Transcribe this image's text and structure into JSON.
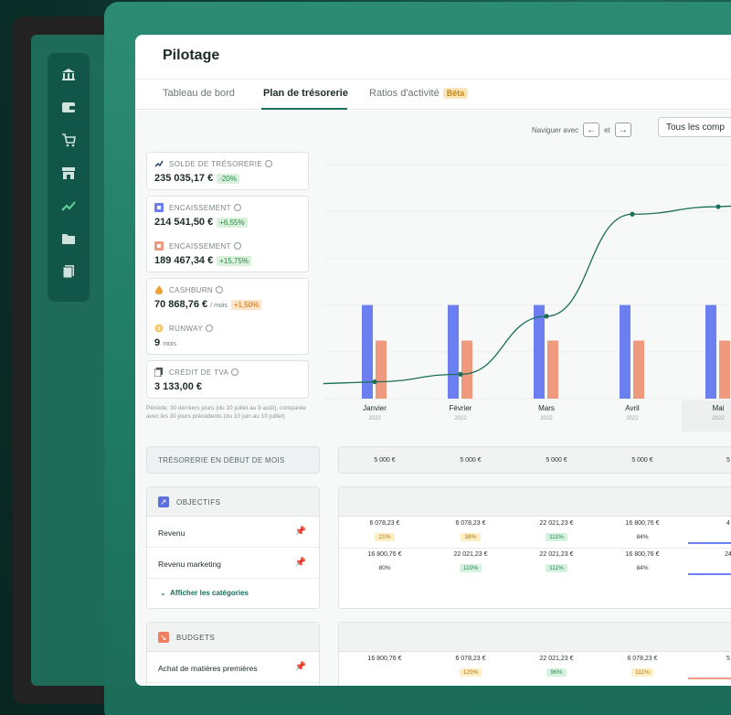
{
  "app": {
    "title": "Pilotage",
    "tabs": [
      {
        "label": "Tableau de bord",
        "active": false
      },
      {
        "label": "Plan de trésorerie",
        "active": true
      },
      {
        "label": "Ratios d'activité",
        "active": false,
        "badge": "Bêta"
      }
    ]
  },
  "toolbar": {
    "nav_text_before": "Naviguer avec",
    "nav_text_middle": "et",
    "left_key": "←",
    "right_key": "→",
    "filter_value": "Tous les comp"
  },
  "sidebar_icons": [
    "bank-icon",
    "wallet-icon",
    "cart-icon",
    "store-icon",
    "trend-icon",
    "folder-icon",
    "documents-icon"
  ],
  "kpis": {
    "solde": {
      "label": "SOLDE DE TRÉSORERIE",
      "value": "235 035,17 €",
      "delta": "-20%"
    },
    "encaissement_in": {
      "label": "ENCAISSEMENT",
      "value": "214 541,50 €",
      "delta": "+6,55%"
    },
    "encaissement_out": {
      "label": "ENCAISSEMENT",
      "value": "189 467,34 €",
      "delta": "+15,75%"
    },
    "cashburn": {
      "label": "CASHBURN",
      "value": "70 868,76 €",
      "unit": "/ mois",
      "delta": "+1,50%"
    },
    "runway": {
      "label": "RUNWAY",
      "value": "9",
      "unit": "mois"
    },
    "credit_tva": {
      "label": "CRÉDIT DE TVA",
      "value": "3 133,00 €"
    }
  },
  "period_note": "Période: 30 derniers jours (du 10 juillet au 9 août), comparée avec les 30 jours précédents (du 10 juin au 10 juillet)",
  "colors": {
    "brand": "#1a6e5a",
    "bar_in": "#6b7ff0",
    "bar_out": "#ef9a7f",
    "line": "#1a6e5a"
  },
  "chart_data": {
    "type": "bar",
    "categories": [
      "Janvier",
      "Février",
      "Mars",
      "Avril",
      "Mai"
    ],
    "category_years": [
      "2022",
      "2022",
      "2022",
      "2022",
      "2022"
    ],
    "series": [
      {
        "name": "",
        "type": "bar",
        "values": [
          100,
          100,
          100,
          100,
          100
        ]
      },
      {
        "name": "",
        "type": "bar",
        "values": [
          62,
          62,
          62,
          62,
          62
        ]
      },
      {
        "name": "",
        "type": "line",
        "values": [
          18,
          26,
          88,
          197,
          205
        ]
      }
    ],
    "ylim": [
      0,
      250
    ],
    "grid": true,
    "xlabel": "",
    "ylabel": ""
  },
  "treso_debut": {
    "label": "TRÉSORERIE EN DÉBUT DE MOIS",
    "values": [
      "5 000 €",
      "5 000 €",
      "5 000 €",
      "5 000 €",
      "5"
    ]
  },
  "objectifs": {
    "title": "OBJECTIFS",
    "rows": [
      {
        "label": "Revenu",
        "values": [
          {
            "amount": "6 078,23 €",
            "pct": "21%",
            "style": "yellow"
          },
          {
            "amount": "6 078,23 €",
            "pct": "38%",
            "style": "yellow"
          },
          {
            "amount": "22 021,23 €",
            "pct": "111%",
            "style": "green"
          },
          {
            "amount": "16 800,76 €",
            "pct": "84%",
            "style": "plain"
          },
          {
            "amount": "4",
            "pct": "",
            "style": "plain"
          }
        ]
      },
      {
        "label": "Revenu marketing",
        "values": [
          {
            "amount": "16 800,76 €",
            "pct": "80%",
            "style": "plain"
          },
          {
            "amount": "22 021,23 €",
            "pct": "110%",
            "style": "green"
          },
          {
            "amount": "22 021,23 €",
            "pct": "111%",
            "style": "green"
          },
          {
            "amount": "16 800,76 €",
            "pct": "84%",
            "style": "plain"
          },
          {
            "amount": "24",
            "pct": "",
            "style": "plain"
          }
        ]
      }
    ],
    "show_categories": "Afficher les catégories"
  },
  "budgets": {
    "title": "BUDGETS",
    "rows": [
      {
        "label": "Achat de matières premières",
        "values": [
          {
            "amount": "16 800,76 €",
            "pct": "",
            "style": "plain"
          },
          {
            "amount": "6 078,23 €",
            "pct": "120%",
            "style": "yellow"
          },
          {
            "amount": "22 021,23 €",
            "pct": "96%",
            "style": "green"
          },
          {
            "amount": "6 078,23 €",
            "pct": "111%",
            "style": "yellow"
          },
          {
            "amount": "5",
            "pct": "",
            "style": "plain"
          }
        ]
      }
    ]
  }
}
